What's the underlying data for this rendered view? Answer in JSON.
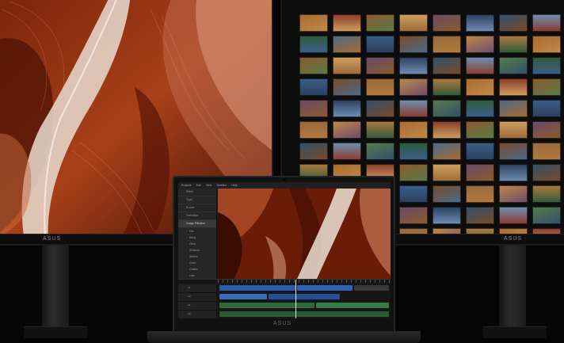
{
  "left_monitor": {
    "brand": "ASUS",
    "wallpaper": "red-canyon-brushstroke-art"
  },
  "right_monitor": {
    "brand": "ASUS",
    "thumbnail_rows": 11,
    "thumbnail_cols": 9,
    "thumbnail_palette": [
      "#3b5f8a",
      "#8a5a2a",
      "#2e5a3a",
      "#a86a30",
      "#6f8fb4",
      "#c08a4a",
      "#2c3e5c",
      "#7a4a2a",
      "#d0a060",
      "#4a6a8a",
      "#8a3a2a",
      "#5a7a4a",
      "#b07a40",
      "#30506a",
      "#9a6a3a",
      "#6a4a6a"
    ]
  },
  "laptop": {
    "brand": "ASUS",
    "editor": {
      "menu": [
        "Projects",
        "Edit",
        "View",
        "Timeline",
        "Help"
      ],
      "effects_panel": {
        "items": [
          "Effect",
          "Type",
          "B-Line",
          "Transition",
          "Image Filtration"
        ],
        "selected_index": 4,
        "sub_items": [
          "Fan",
          "Bling",
          "Glow",
          "Shadow",
          "Sketch",
          "Color",
          "Outline",
          "Line",
          "Wiz"
        ]
      },
      "timeline": {
        "tracks": [
          {
            "label": "V1"
          },
          {
            "label": "V2"
          },
          {
            "label": "A1"
          },
          {
            "label": "A2"
          }
        ],
        "playhead_fraction": 0.45
      }
    }
  }
}
